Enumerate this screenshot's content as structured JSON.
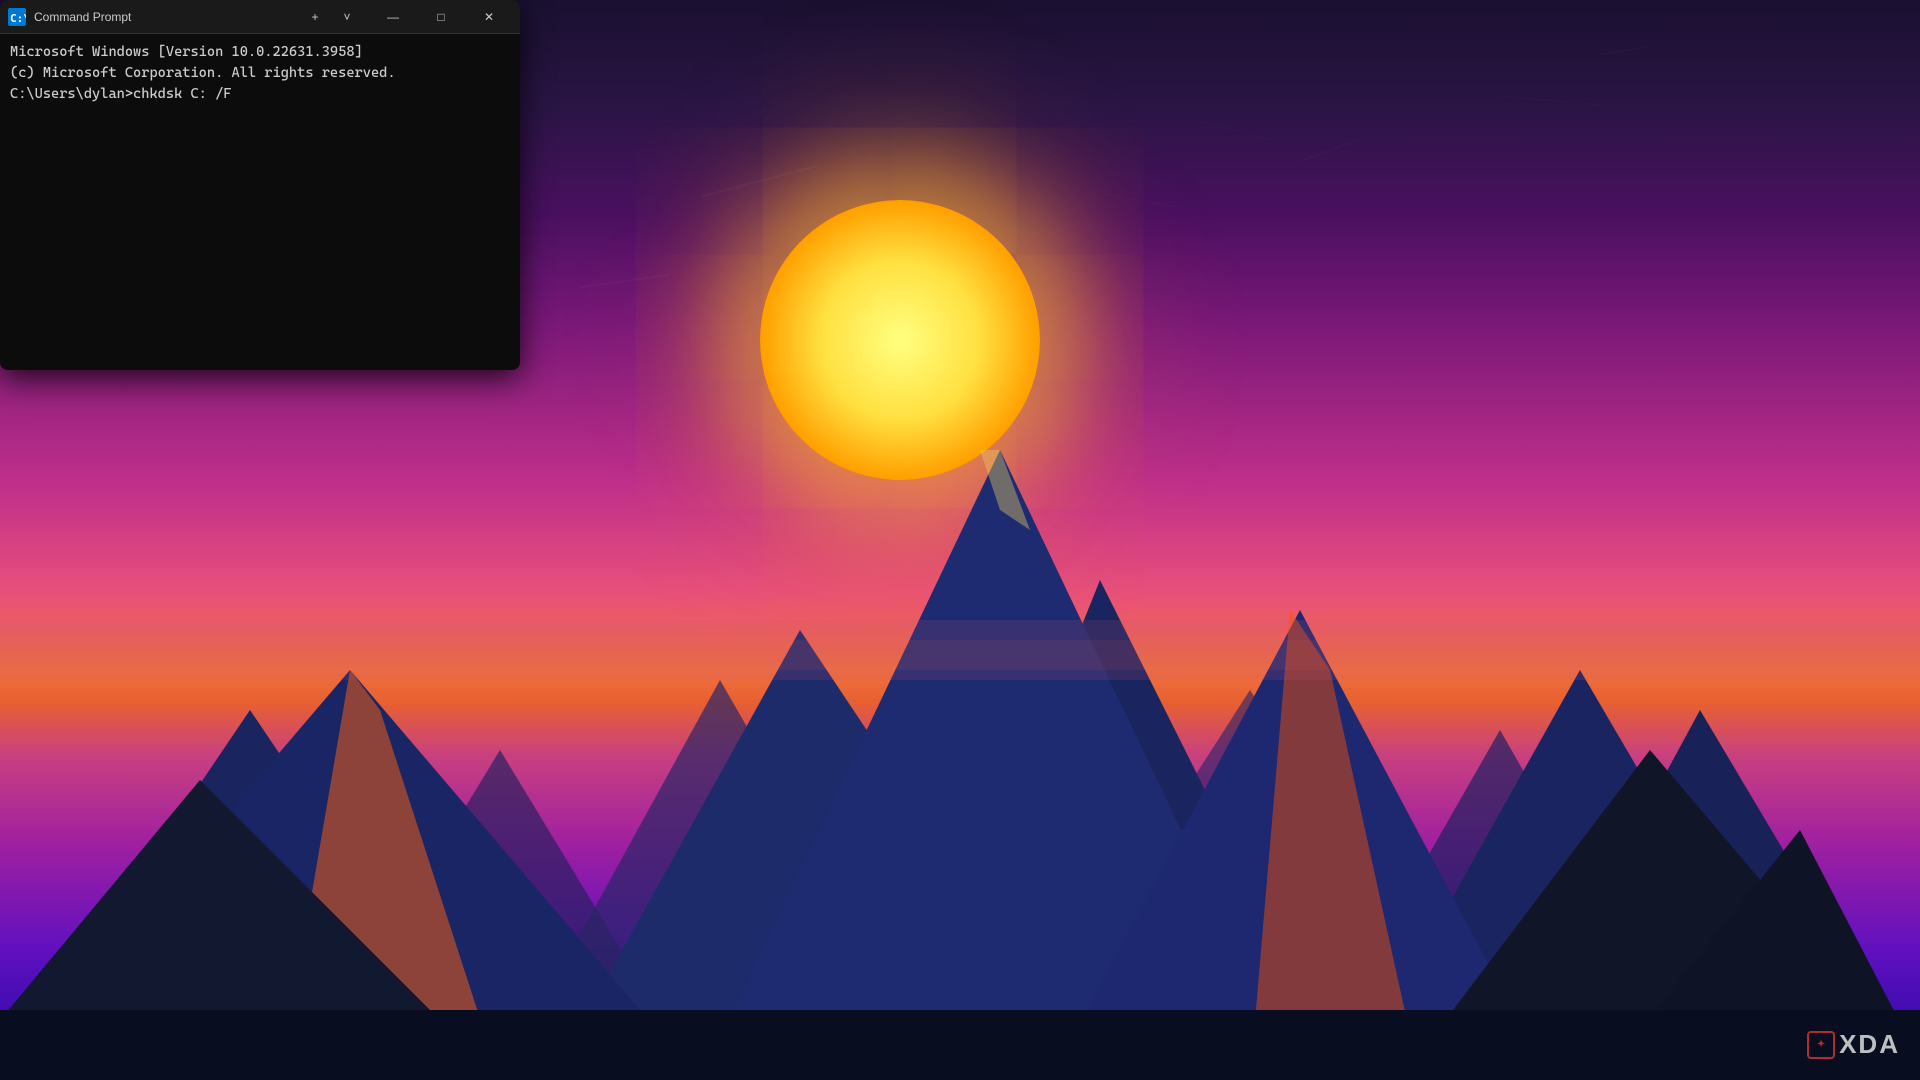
{
  "wallpaper": {
    "alt": "Colorful mountain sunset wallpaper"
  },
  "xda": {
    "logo_text": "□",
    "brand_text": "XDA",
    "color": "#cc3333"
  },
  "cmd_window": {
    "title": "Command Prompt",
    "icon_unicode": "▣",
    "line1": "Microsoft Windows [Version 10.0.22631.3958]",
    "line2": "(c) Microsoft Corporation. All rights reserved.",
    "line3": "",
    "line4": "C:\\Users\\dylan>chkdsk C: /F",
    "controls": {
      "minimize": "—",
      "maximize": "□",
      "close": "✕",
      "new_tab": "+",
      "dropdown": "˅"
    }
  }
}
